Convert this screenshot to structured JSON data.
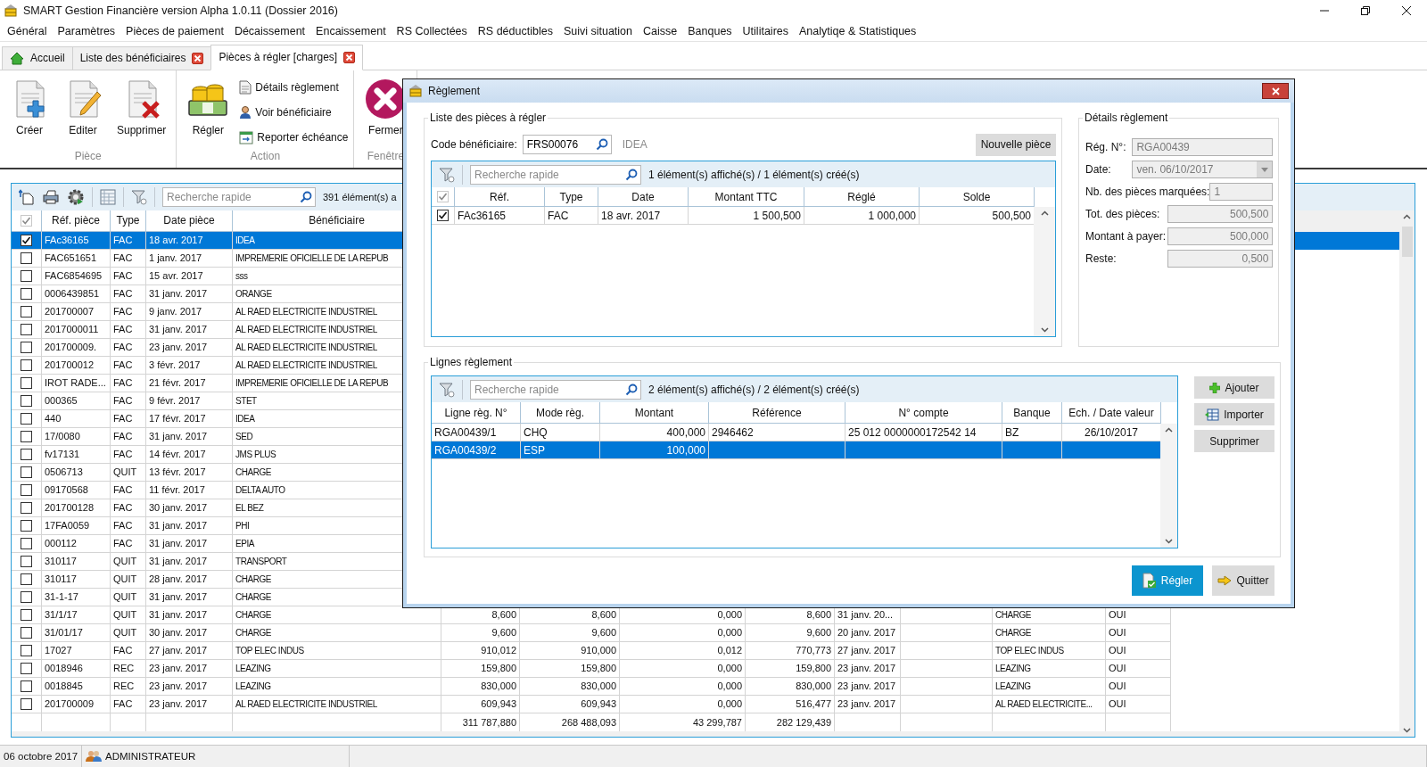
{
  "window": {
    "title": "SMART Gestion Financière version Alpha 1.0.11 (Dossier 2016)"
  },
  "menu": [
    "Général",
    "Paramètres",
    "Pièces de paiement",
    "Décaissement",
    "Encaissement",
    "RS Collectées",
    "RS déductibles",
    "Suivi situation",
    "Caisse",
    "Banques",
    "Utilitaires",
    "Analytiqe & Statistiques"
  ],
  "tabs": [
    {
      "label": "Accueil",
      "selected": false,
      "closable": false
    },
    {
      "label": "Liste des bénéficiaires",
      "selected": false,
      "closable": true
    },
    {
      "label": "Pièces à régler [charges]",
      "selected": true,
      "closable": true
    }
  ],
  "ribbon": {
    "groups": [
      {
        "label": "Pièce",
        "items": [
          {
            "label": "Créer",
            "kind": "large"
          },
          {
            "label": "Editer",
            "kind": "large"
          },
          {
            "label": "Supprimer",
            "kind": "large"
          }
        ]
      },
      {
        "label": "Action",
        "items": [
          {
            "label": "Régler",
            "kind": "large"
          },
          {
            "label": "Détails règlement",
            "kind": "small"
          },
          {
            "label": "Voir bénéficiaire",
            "kind": "small"
          },
          {
            "label": "Reporter échéance",
            "kind": "small"
          }
        ]
      },
      {
        "label": "Fenêtre",
        "items": [
          {
            "label": "Fermer",
            "kind": "large"
          }
        ]
      }
    ]
  },
  "grid": {
    "search": {
      "placeholder": "Recherche rapide"
    },
    "count": "391 élément(s) a",
    "all_checked": true,
    "columns": [
      "Réf. pièce",
      "Type",
      "Date pièce",
      "Bénéficiaire"
    ],
    "rows": [
      {
        "checked": true,
        "selected": true,
        "ref": "FAc36165",
        "type": "FAC",
        "date": "18 avr. 2017",
        "beneficiary": "IDEA"
      },
      {
        "checked": false,
        "selected": false,
        "ref": "FAC651651",
        "type": "FAC",
        "date": "1 janv. 2017",
        "beneficiary": "IMPREMERIE OFICIELLE DE LA REPUB"
      },
      {
        "checked": false,
        "selected": false,
        "ref": "FAC6854695",
        "type": "FAC",
        "date": "15 avr. 2017",
        "beneficiary": "sss"
      },
      {
        "checked": false,
        "selected": false,
        "ref": "0006439851",
        "type": "FAC",
        "date": "31 janv. 2017",
        "beneficiary": "ORANGE"
      },
      {
        "checked": false,
        "selected": false,
        "ref": "201700007",
        "type": "FAC",
        "date": "9 janv. 2017",
        "beneficiary": "AL RAED ELECTRICITE INDUSTRIEL"
      },
      {
        "checked": false,
        "selected": false,
        "ref": "2017000011",
        "type": "FAC",
        "date": "31 janv. 2017",
        "beneficiary": "AL RAED ELECTRICITE INDUSTRIEL"
      },
      {
        "checked": false,
        "selected": false,
        "ref": "201700009.",
        "type": "FAC",
        "date": "23 janv. 2017",
        "beneficiary": "AL RAED ELECTRICITE INDUSTRIEL"
      },
      {
        "checked": false,
        "selected": false,
        "ref": "201700012",
        "type": "FAC",
        "date": "3 févr. 2017",
        "beneficiary": "AL RAED ELECTRICITE INDUSTRIEL"
      },
      {
        "checked": false,
        "selected": false,
        "ref": "IROT RADE...",
        "type": "FAC",
        "date": "21 févr. 2017",
        "beneficiary": "IMPREMERIE OFICIELLE DE LA REPUB"
      },
      {
        "checked": false,
        "selected": false,
        "ref": "000365",
        "type": "FAC",
        "date": "9 févr. 2017",
        "beneficiary": "STET"
      },
      {
        "checked": false,
        "selected": false,
        "ref": "440",
        "type": "FAC",
        "date": "17 févr. 2017",
        "beneficiary": "IDEA"
      },
      {
        "checked": false,
        "selected": false,
        "ref": "17/0080",
        "type": "FAC",
        "date": "31 janv. 2017",
        "beneficiary": "SED"
      },
      {
        "checked": false,
        "selected": false,
        "ref": "fv17131",
        "type": "FAC",
        "date": "14 févr. 2017",
        "beneficiary": "JMS PLUS"
      },
      {
        "checked": false,
        "selected": false,
        "ref": "0506713",
        "type": "QUIT",
        "date": "13 févr. 2017",
        "beneficiary": "CHARGE"
      },
      {
        "checked": false,
        "selected": false,
        "ref": "09170568",
        "type": "FAC",
        "date": "11 févr. 2017",
        "beneficiary": "DELTA AUTO"
      },
      {
        "checked": false,
        "selected": false,
        "ref": "201700128",
        "type": "FAC",
        "date": "30 janv. 2017",
        "beneficiary": "EL BEZ"
      },
      {
        "checked": false,
        "selected": false,
        "ref": "17FA0059",
        "type": "FAC",
        "date": "31 janv. 2017",
        "beneficiary": "PHI"
      },
      {
        "checked": false,
        "selected": false,
        "ref": "000112",
        "type": "FAC",
        "date": "31 janv. 2017",
        "beneficiary": "EPIA"
      },
      {
        "checked": false,
        "selected": false,
        "ref": "310117",
        "type": "QUIT",
        "date": "31 janv. 2017",
        "beneficiary": "TRANSPORT"
      },
      {
        "checked": false,
        "selected": false,
        "ref": "310117",
        "type": "QUIT",
        "date": "28 janv. 2017",
        "beneficiary": "CHARGE"
      },
      {
        "checked": false,
        "selected": false,
        "ref": "31-1-17",
        "type": "QUIT",
        "date": "31 janv. 2017",
        "beneficiary": "CHARGE"
      },
      {
        "checked": false,
        "selected": false,
        "ref": "31/1/17",
        "type": "QUIT",
        "date": "31 janv. 2017",
        "beneficiary": "CHARGE",
        "amounts": [
          "8,600",
          "8,600",
          "0,000",
          "8,600"
        ],
        "due_date": "31 janv. 20...",
        "party": "CHARGE",
        "status": "OUI"
      },
      {
        "checked": false,
        "selected": false,
        "ref": "31/01/17",
        "type": "QUIT",
        "date": "30 janv. 2017",
        "beneficiary": "CHARGE",
        "amounts": [
          "9,600",
          "9,600",
          "0,000",
          "9,600"
        ],
        "due_date": "20 janv. 2017",
        "party": "CHARGE",
        "status": "OUI"
      },
      {
        "checked": false,
        "selected": false,
        "ref": "17027",
        "type": "FAC",
        "date": "27 janv. 2017",
        "beneficiary": "TOP ELEC INDUS",
        "amounts": [
          "910,012",
          "910,000",
          "0,012",
          "770,773"
        ],
        "due_date": "27 janv. 2017",
        "party": "TOP ELEC INDUS",
        "status": "OUI"
      },
      {
        "checked": false,
        "selected": false,
        "ref": "0018946",
        "type": "REC",
        "date": "23 janv. 2017",
        "beneficiary": "LEAZING",
        "amounts": [
          "159,800",
          "159,800",
          "0,000",
          "159,800"
        ],
        "due_date": "23 janv. 2017",
        "party": "LEAZING",
        "status": "OUI"
      },
      {
        "checked": false,
        "selected": false,
        "ref": "0018845",
        "type": "REC",
        "date": "23 janv. 2017",
        "beneficiary": "LEAZING",
        "amounts": [
          "830,000",
          "830,000",
          "0,000",
          "830,000"
        ],
        "due_date": "23 janv. 2017",
        "party": "LEAZING",
        "status": "OUI"
      },
      {
        "checked": false,
        "selected": false,
        "ref": "201700009",
        "type": "FAC",
        "date": "23 janv. 2017",
        "beneficiary": "AL RAED ELECTRICITE INDUSTRIEL",
        "amounts": [
          "609,943",
          "609,943",
          "0,000",
          "516,477"
        ],
        "due_date": "23 janv. 2017",
        "party": "AL RAED ELECTRICITE...",
        "status": "OUI"
      }
    ],
    "totals": [
      "311 787,880",
      "268 488,093",
      "43 299,787",
      "282 129,439"
    ]
  },
  "dialog": {
    "title": "Règlement",
    "pieces": {
      "title": "Liste des pièces à régler",
      "code_label": "Code bénéficiaire:",
      "code_value": "FRS00076",
      "beneficiary_name": "IDEA",
      "new_button": "Nouvelle pièce",
      "search": {
        "placeholder": "Recherche rapide"
      },
      "count": "1 élément(s) affiché(s) / 1 élément(s) créé(s)",
      "all_checked": true,
      "columns": [
        "Réf.",
        "Type",
        "Date",
        "Montant TTC",
        "Réglé",
        "Solde"
      ],
      "rows": [
        {
          "checked": true,
          "cells": [
            "FAc36165",
            "FAC",
            "18 avr. 2017",
            "1 500,500",
            "1 000,000",
            "500,500"
          ]
        }
      ]
    },
    "details": {
      "title": "Détails règlement",
      "fields": [
        {
          "label": "Rég. N°:",
          "value": "RGA00439",
          "kind": "text"
        },
        {
          "label": "Date:",
          "value": "ven. 06/10/2017",
          "kind": "dropdown"
        },
        {
          "label": "Nb. des pièces marquées:",
          "value": "1",
          "kind": "short"
        },
        {
          "label": "Tot. des pièces:",
          "value": "500,500",
          "kind": "amount"
        },
        {
          "label": "Montant à payer:",
          "value": "500,000",
          "kind": "amount"
        },
        {
          "label": "Reste:",
          "value": "0,500",
          "kind": "amount"
        }
      ]
    },
    "lines": {
      "title": "Lignes règlement",
      "search": {
        "placeholder": "Recherche rapide"
      },
      "count": "2 élément(s) affiché(s) / 2 élément(s) créé(s)",
      "columns": [
        "Ligne règ. N°",
        "Mode règ.",
        "Montant",
        "Référence",
        "N° compte",
        "Banque",
        "Ech. / Date valeur"
      ],
      "rows": [
        {
          "selected": false,
          "line": "RGA00439/1",
          "mode": "CHQ",
          "amount": "400,000",
          "reference": "2946462",
          "account": "25 012 0000000172542 14",
          "bank": "BZ",
          "value_date": "26/10/2017"
        },
        {
          "selected": true,
          "line": "RGA00439/2",
          "mode": "ESP",
          "amount": "100,000"
        }
      ],
      "buttons": [
        "Ajouter",
        "Importer",
        "Supprimer"
      ]
    },
    "actions": [
      {
        "label": "Régler",
        "primary": true
      },
      {
        "label": "Quitter",
        "primary": false
      }
    ]
  },
  "status_bar": {
    "date": "06 octobre 2017",
    "user": "ADMINISTRATEUR"
  }
}
